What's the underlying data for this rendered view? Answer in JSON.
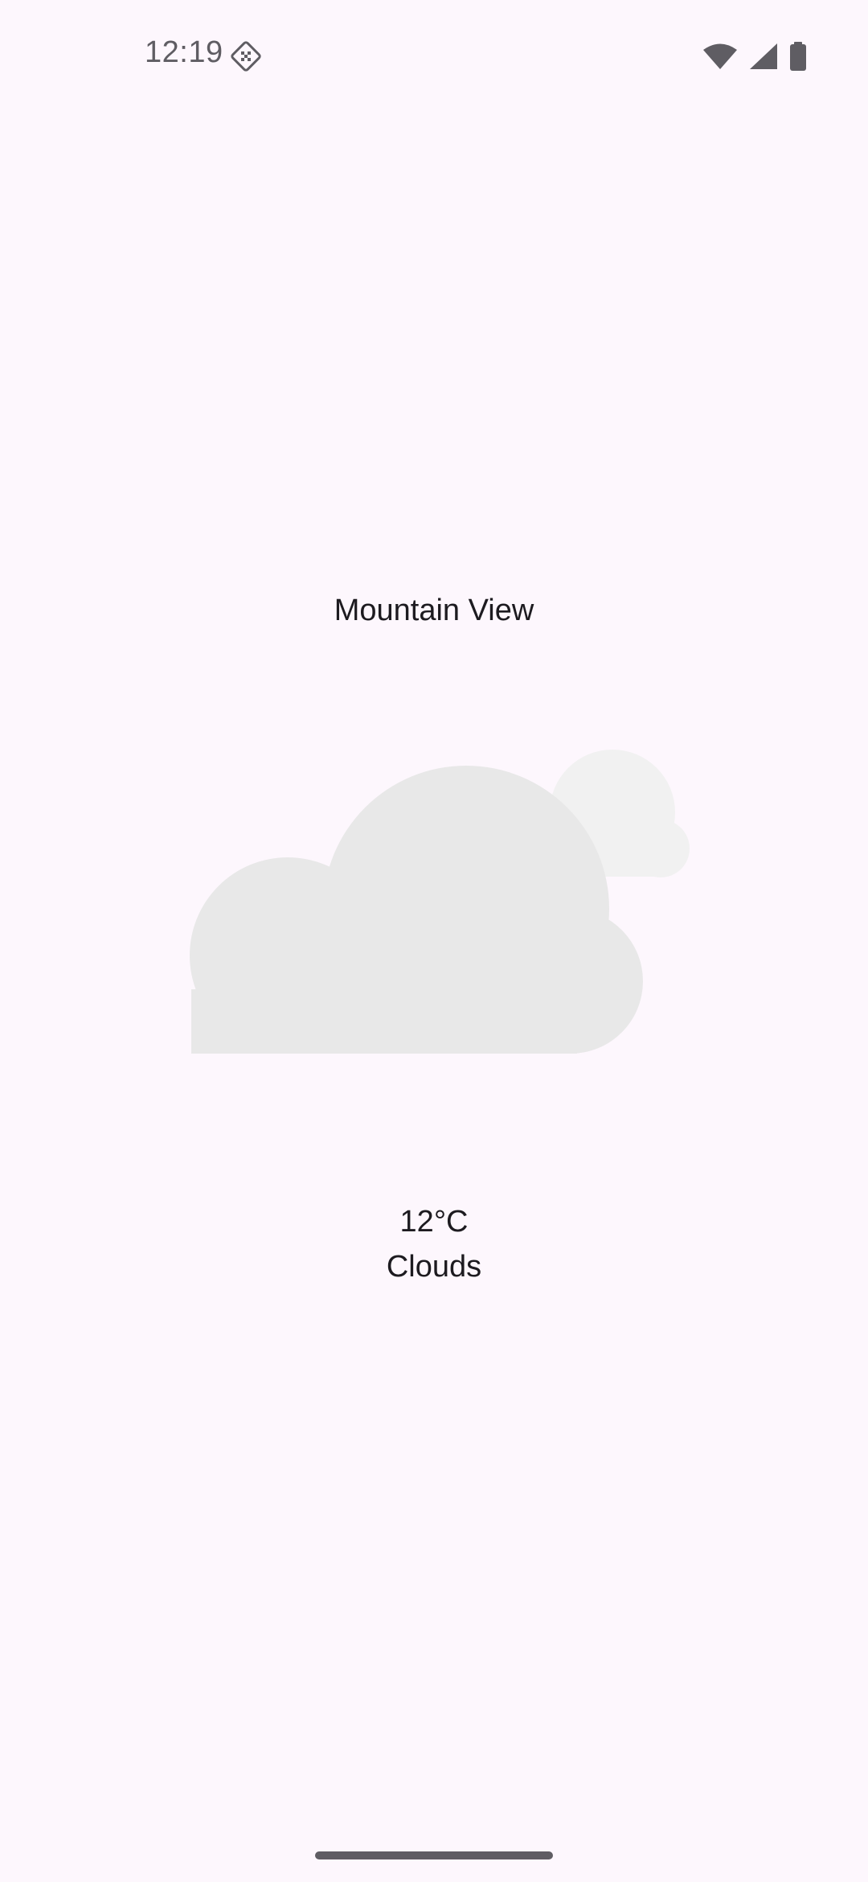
{
  "status_bar": {
    "time": "12:19",
    "icons": [
      "app-notification-icon",
      "wifi-icon",
      "cellular-signal-icon",
      "battery-icon"
    ],
    "icon_color": "#5f5d63"
  },
  "weather": {
    "location": "Mountain View",
    "temperature": "12°C",
    "condition": "Clouds",
    "illustration_icon": "clouds-icon",
    "cloud_colors": {
      "front": "#e8e8e8",
      "back": "#f1f1f1"
    }
  },
  "navigation": {
    "gesture_handle": "home-gesture-bar"
  },
  "colors": {
    "background": "#fdf7fd",
    "text": "#1d1b20"
  }
}
